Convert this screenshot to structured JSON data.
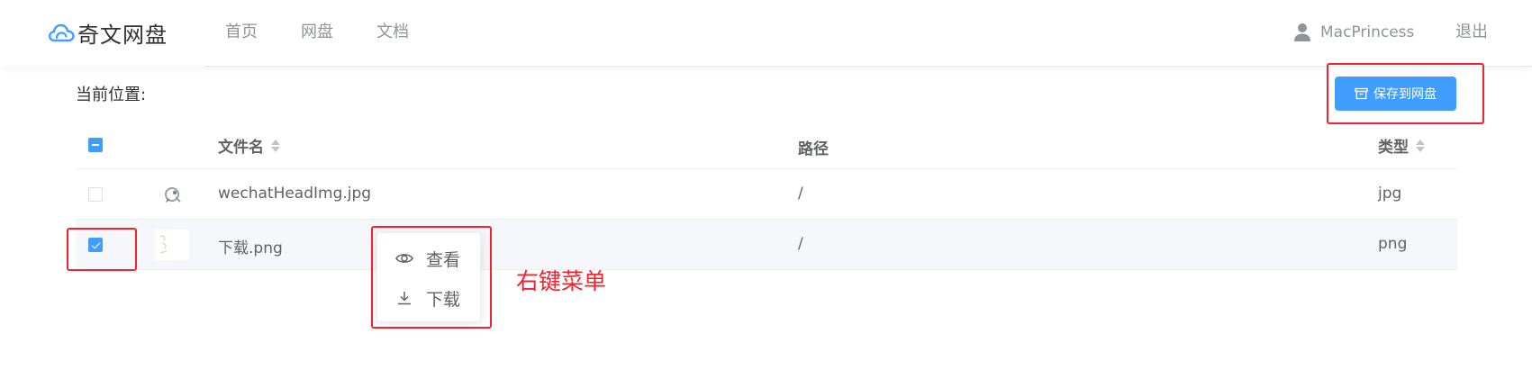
{
  "header": {
    "logo_text": "奇文网盘",
    "nav": [
      "首页",
      "网盘",
      "文档"
    ],
    "user_name": "MacPrincess",
    "logout": "退出"
  },
  "location_label": "当前位置:",
  "save_button": "保存到网盘",
  "table": {
    "columns": {
      "name": "文件名",
      "path": "路径",
      "type": "类型"
    },
    "rows": [
      {
        "name": "wechatHeadImg.jpg",
        "path": "/",
        "type": "jpg",
        "checked": false
      },
      {
        "name": "下载.png",
        "path": "/",
        "type": "png",
        "checked": true
      }
    ]
  },
  "context_menu": {
    "view": "查看",
    "download": "下载"
  },
  "annotation": "右键菜单",
  "colors": {
    "accent": "#409eff",
    "annotation": "#f5222d"
  }
}
